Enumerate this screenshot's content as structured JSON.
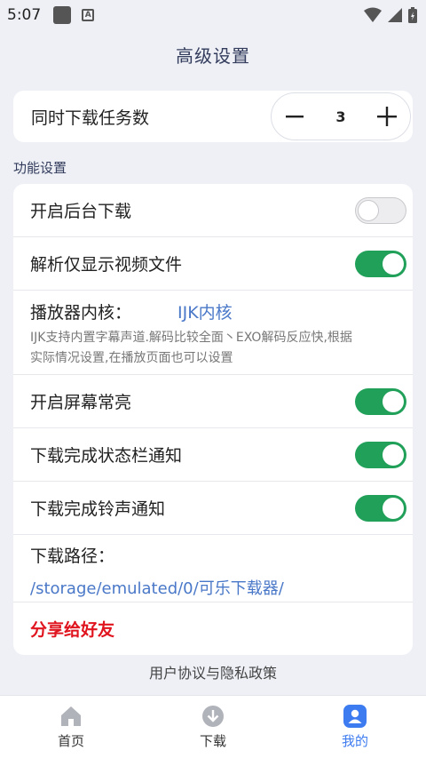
{
  "status_bar": {
    "time": "5:07",
    "a_label": "A"
  },
  "header": {
    "title": "高级设置"
  },
  "concurrent_downloads": {
    "label": "同时下载任务数",
    "value": "3"
  },
  "section": {
    "title": "功能设置"
  },
  "settings": {
    "background_download": {
      "label": "开启后台下载",
      "enabled": false
    },
    "parse_video_only": {
      "label": "解析仅显示视频文件",
      "enabled": true
    },
    "player_core": {
      "label": "播放器内核：",
      "value": "IJK内核",
      "description": "IJK支持内置字幕声道.解码比较全面丶EXO解码反应快,根据实际情况设置,在播放页面也可以设置"
    },
    "screen_on": {
      "label": "开启屏幕常亮",
      "enabled": true
    },
    "statusbar_notify": {
      "label": "下载完成状态栏通知",
      "enabled": true
    },
    "ringtone_notify": {
      "label": "下载完成铃声通知",
      "enabled": true
    },
    "download_path": {
      "label": "下载路径：",
      "value": "/storage/emulated/0/可乐下载器/"
    },
    "share": {
      "label": "分享给好友"
    }
  },
  "privacy": {
    "label": "用户协议与隐私政策"
  },
  "bottom_nav": {
    "items": [
      {
        "label": "首页",
        "icon": "home-icon"
      },
      {
        "label": "下载",
        "icon": "download-icon"
      },
      {
        "label": "我的",
        "icon": "profile-icon",
        "active": true
      }
    ]
  },
  "colors": {
    "toggle_on": "#21a05a",
    "link": "#4a78c8",
    "share": "#e0141e",
    "nav_active": "#3d7bf0"
  }
}
